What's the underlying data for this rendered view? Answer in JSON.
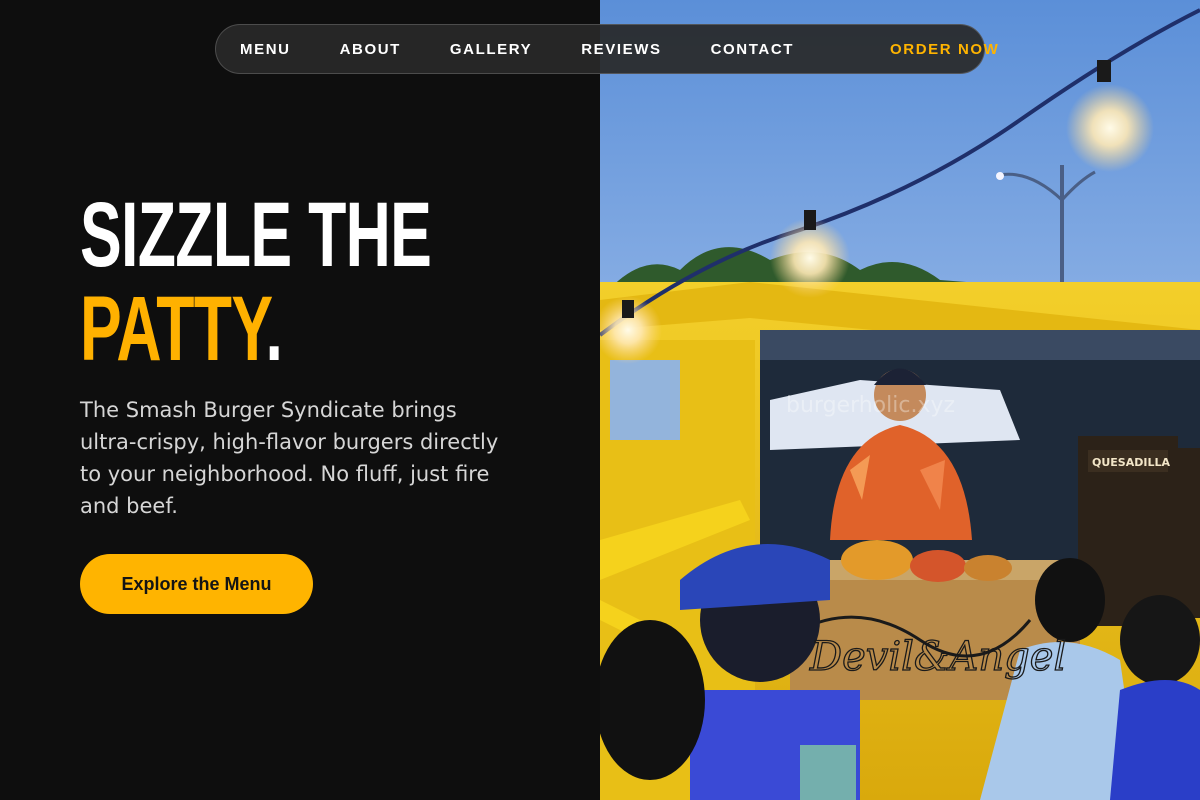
{
  "nav": {
    "items": [
      "MENU",
      "ABOUT",
      "GALLERY",
      "REVIEWS",
      "CONTACT"
    ],
    "order_label": "ORDER NOW"
  },
  "hero": {
    "headline_line1": "SIZZLE THE",
    "headline_accent": "PATTY",
    "headline_dot": ".",
    "description": "The Smash Burger Syndicate brings ultra-crispy, high-flavor burgers directly to your neighborhood. No fluff, just fire and beef.",
    "cta_label": "Explore the Menu"
  },
  "photo": {
    "watermark": "burgerholic.xyz",
    "truck_sign": "Devil&Angel",
    "menu_board_title": "QUESADILLA"
  },
  "colors": {
    "accent": "#ffb400",
    "background": "#0e0e0e",
    "truck_yellow": "#f2c81a"
  }
}
